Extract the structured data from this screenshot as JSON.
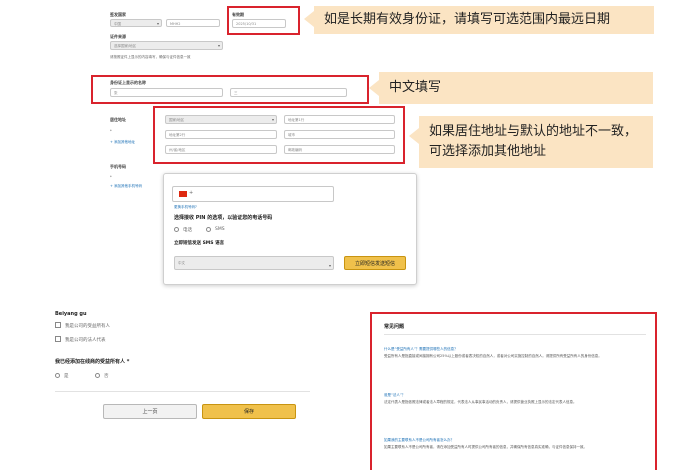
{
  "form": {
    "expiry_label": "有效期",
    "expiry_value": "2025/10/31",
    "issue_country_label": "签发国家",
    "issue_country_value": "中国",
    "doc_label": "证件号码",
    "doc_value": "MHH2",
    "source_label": "证件来源",
    "source_value": "选择国家/地区",
    "source_note": "请按照证件上显示的内容填写，确保与证件信息一致",
    "name_label": "身份证上显示的名称",
    "surname_value": "张",
    "given_value": "三",
    "address_label": "居住地址",
    "address_fields": [
      "地址第1行",
      "地址第2行",
      "城市",
      "州/省/地区",
      "邮政编码",
      "国家/地区"
    ],
    "add_address_link": "+ 添加其他地址",
    "phone_label": "手机号码",
    "add_phone_link": "+ 添加其他手机号码"
  },
  "callouts": {
    "expiry": "如是长期有效身份证，请填写可选范围内最远日期",
    "chinese": "中文填写",
    "address_line1": "如果居住地址与默认的地址不一致，",
    "address_line2": "可选择添加其他地址"
  },
  "phone_popup": {
    "country_code": "+",
    "change_link": "更换手机号码?",
    "instruction": "选择接收 PIN 的选项，以验证您的电话号码",
    "option_call": "电话",
    "option_sms": "SMS",
    "language_label": "立即短信发送 SMS 语言",
    "language_value": "中文",
    "send_button": "立即短信发送短信"
  },
  "bottom": {
    "section_title": "Beiyang gu",
    "checkbox1": "我是公司的受益所有人",
    "checkbox2": "我是公司的法人代表",
    "question": "我已经添加在线商的受益所有人 *",
    "yes": "是",
    "no": "否",
    "prev_button": "上一页",
    "save_button": "保存"
  },
  "faq": {
    "title": "常见问题",
    "items": [
      {
        "q": "什么是“受益所有人”？需要提供哪些人的信息？",
        "a": "受益所有人是指直接或间接拥有公司25%以上股份或者表决权的自然人，或者对公司实施控制的自然人。请提供所有受益所有人的身份信息。"
      },
      {
        "q": "谁是“法人”？",
        "a": "法定代表人是指依照法律或者法人章程的规定，代表法人从事民事活动的负责人，请提供营业执照上显示的法定代表人信息。"
      },
      {
        "q": "如果我的主要联系人不是公司所有者怎么办？",
        "a": "如果主要联系人不是公司所有者，请在添加受益所有人时提供公司所有者的信息，并确保所有信息真实准确，与证件信息保持一致。"
      }
    ]
  },
  "colors": {
    "highlight": "#d9232d",
    "callout_bg": "#fbe4c3",
    "link": "#1a6fb5",
    "save_button": "#f0c14b"
  }
}
